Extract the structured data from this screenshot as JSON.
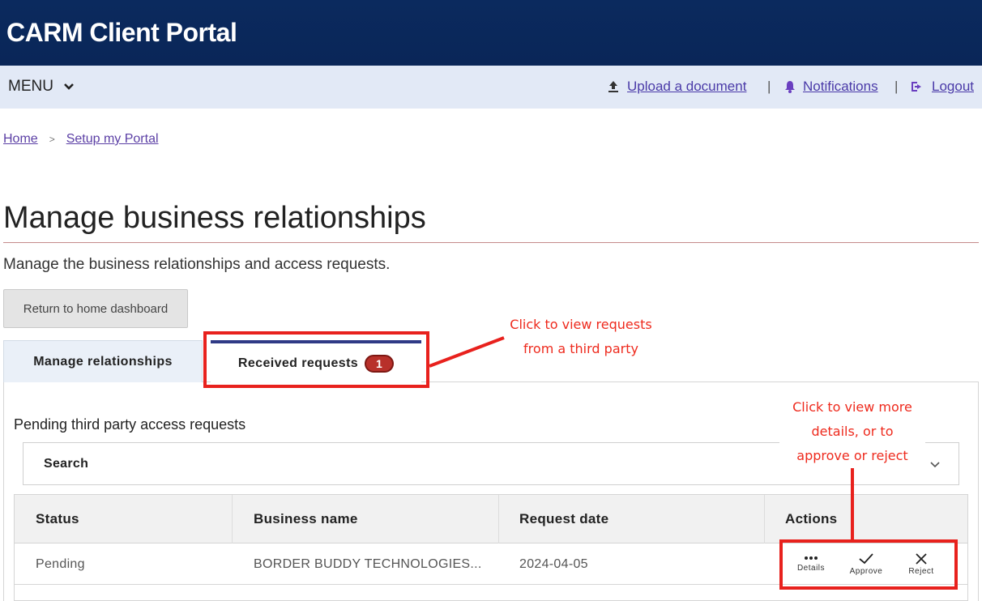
{
  "header": {
    "title": "CARM Client Portal"
  },
  "menubar": {
    "menu_label": "MENU",
    "upload_label": "Upload a document",
    "notifications_label": "Notifications",
    "logout_label": "Logout",
    "separator": "|"
  },
  "breadcrumb": {
    "home": "Home",
    "separator": ">",
    "current": "Setup my Portal"
  },
  "page": {
    "title": "Manage business relationships",
    "description": "Manage the business relationships and access requests.",
    "return_button": "Return to home dashboard"
  },
  "tabs": [
    {
      "label": "Manage relationships",
      "active": false
    },
    {
      "label": "Received requests",
      "badge": "1",
      "active": true
    }
  ],
  "requests": {
    "section_title": "Pending third party access requests",
    "search_label": "Search",
    "columns": [
      "Status",
      "Business name",
      "Request date",
      "Actions"
    ],
    "rows": [
      {
        "status": "Pending",
        "business_name": "BORDER BUDDY TECHNOLOGIES...",
        "request_date": "2024-04-05"
      }
    ],
    "actions": [
      "Details",
      "Approve",
      "Reject"
    ]
  },
  "annotations": {
    "tab_callout_line1": "Click to view requests",
    "tab_callout_line2": "from a third party",
    "action_callout_line1": "Click to view more",
    "action_callout_line2": "details, or to",
    "action_callout_line3": "approve or reject",
    "color": "#e8211d"
  },
  "colors": {
    "header_bg": "#0b2a5e",
    "menubar_bg": "#e2e9f6",
    "link": "#5b3fa5",
    "badge": "#b8302a",
    "active_tab": "#2f3a86"
  }
}
